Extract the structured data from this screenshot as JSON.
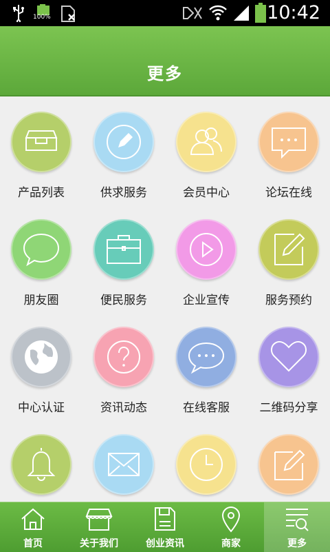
{
  "status_bar": {
    "time": "10:42",
    "battery_left_label": "100%",
    "icons": [
      "usb-icon",
      "battery-icon",
      "sim-icon",
      "mute-icon",
      "wifi-icon",
      "signal-icon",
      "battery-icon"
    ]
  },
  "header": {
    "title": "更多"
  },
  "grid": {
    "items": [
      {
        "label": "产品列表",
        "icon": "tray-icon",
        "color": "#b5cf6a"
      },
      {
        "label": "供求服务",
        "icon": "pencil-icon",
        "color": "#a9daf3"
      },
      {
        "label": "会员中心",
        "icon": "users-icon",
        "color": "#f6e28e"
      },
      {
        "label": "论坛在线",
        "icon": "chat-dots-icon",
        "color": "#f7c48f"
      },
      {
        "label": "朋友圈",
        "icon": "speech-bubble-icon",
        "color": "#8fd676"
      },
      {
        "label": "便民服务",
        "icon": "briefcase-icon",
        "color": "#67ccb9"
      },
      {
        "label": "企业宣传",
        "icon": "play-icon",
        "color": "#f29ae7"
      },
      {
        "label": "服务预约",
        "icon": "note-edit-icon",
        "color": "#c3cb5a"
      },
      {
        "label": "中心认证",
        "icon": "globe-icon",
        "color": "#bcc2c9"
      },
      {
        "label": "资讯动态",
        "icon": "question-icon",
        "color": "#f7a3b2"
      },
      {
        "label": "在线客服",
        "icon": "chat-dots-icon",
        "color": "#90aee1"
      },
      {
        "label": "二维码分享",
        "icon": "heart-icon",
        "color": "#a794e6"
      },
      {
        "label": "",
        "icon": "bell-icon",
        "color": "#b5cf6a"
      },
      {
        "label": "",
        "icon": "mail-icon",
        "color": "#a9daf3"
      },
      {
        "label": "",
        "icon": "clock-icon",
        "color": "#f6e28e"
      },
      {
        "label": "",
        "icon": "note-edit-icon",
        "color": "#f7c48f"
      }
    ]
  },
  "bottom_nav": {
    "items": [
      {
        "label": "首页",
        "icon": "home-icon"
      },
      {
        "label": "关于我们",
        "icon": "shop-icon"
      },
      {
        "label": "创业资讯",
        "icon": "save-icon"
      },
      {
        "label": "商家",
        "icon": "location-pin-icon"
      },
      {
        "label": "更多",
        "icon": "more-list-icon",
        "active": true
      }
    ]
  },
  "colors": {
    "header_green": "#6ab946",
    "background": "#efefef"
  }
}
